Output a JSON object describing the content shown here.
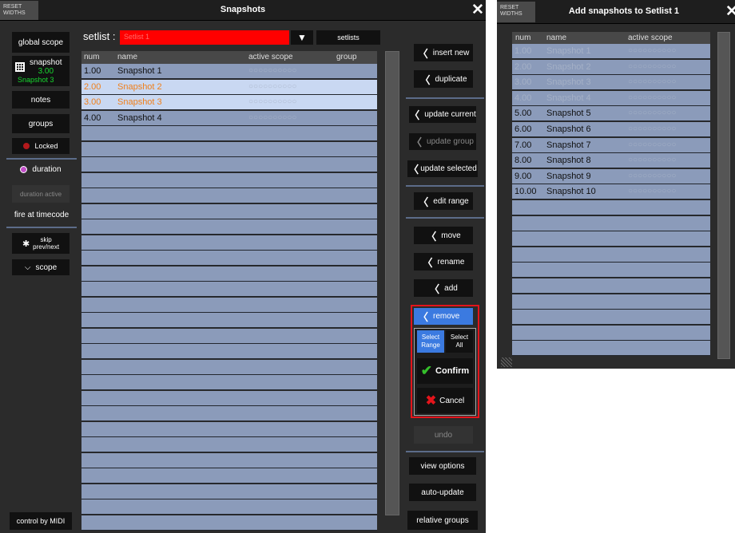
{
  "main": {
    "reset_label": "RESET\nWIDTHS",
    "title": "Snapshots",
    "setlist_label": "setlist :",
    "setlist_value": "Setlist 1",
    "setlists_button": "setlists",
    "columns": [
      "num",
      "name",
      "active scope",
      "group"
    ],
    "rows": [
      {
        "num": "1.00",
        "name": "Snapshot 1",
        "scope": "○○○○○○○○○○",
        "state": "normal"
      },
      {
        "num": "2.00",
        "name": "Snapshot 2",
        "scope": "○○○○○○○○○○",
        "state": "selected"
      },
      {
        "num": "3.00",
        "name": "Snapshot 3",
        "scope": "○○○○○○○○○○",
        "state": "selected"
      },
      {
        "num": "4.00",
        "name": "Snapshot 4",
        "scope": "○○○○○○○○○○",
        "state": "normal"
      }
    ],
    "empty_rows": 26
  },
  "left_panel": {
    "global_scope": "global scope",
    "snapshot_label": "snapshot",
    "snapshot_num": "3.00",
    "snapshot_name": "Snapshot 3",
    "notes": "notes",
    "groups": "groups",
    "locked": "Locked",
    "duration": "duration",
    "duration_active": "duration active",
    "fire_at_timecode": "fire at timecode",
    "skip": "skip\nprev/next",
    "scope": "scope",
    "control_by_midi": "control by MIDI"
  },
  "right_panel": {
    "insert_new": "insert new",
    "duplicate": "duplicate",
    "update_current": "update current",
    "update_group": "update group",
    "update_selected": "update selected",
    "edit_range": "edit range",
    "move": "move",
    "rename": "rename",
    "add": "add",
    "remove": "remove",
    "select_range": "Select\nRange",
    "select_all": "Select\nAll",
    "confirm": "Confirm",
    "cancel": "Cancel",
    "undo": "undo",
    "view_options": "view options",
    "auto_update": "auto-update",
    "relative_groups": "relative groups"
  },
  "add_window": {
    "reset_label": "RESET\nWIDTHS",
    "title": "Add snapshots to Setlist 1",
    "columns": [
      "num",
      "name",
      "active scope"
    ],
    "rows": [
      {
        "num": "1.00",
        "name": "Snapshot 1",
        "scope": "○○○○○○○○○○",
        "state": "disabled"
      },
      {
        "num": "2.00",
        "name": "Snapshot 2",
        "scope": "○○○○○○○○○○",
        "state": "disabled"
      },
      {
        "num": "3.00",
        "name": "Snapshot 3",
        "scope": "○○○○○○○○○○",
        "state": "disabled"
      },
      {
        "num": "4.00",
        "name": "Snapshot 4",
        "scope": "○○○○○○○○○○",
        "state": "disabled"
      },
      {
        "num": "5.00",
        "name": "Snapshot 5",
        "scope": "○○○○○○○○○○",
        "state": "normal"
      },
      {
        "num": "6.00",
        "name": "Snapshot 6",
        "scope": "○○○○○○○○○○",
        "state": "normal"
      },
      {
        "num": "7.00",
        "name": "Snapshot 7",
        "scope": "○○○○○○○○○○",
        "state": "normal"
      },
      {
        "num": "8.00",
        "name": "Snapshot 8",
        "scope": "○○○○○○○○○○",
        "state": "normal"
      },
      {
        "num": "9.00",
        "name": "Snapshot 9",
        "scope": "○○○○○○○○○○",
        "state": "normal"
      },
      {
        "num": "10.00",
        "name": "Snapshot 10",
        "scope": "○○○○○○○○○○",
        "state": "normal"
      }
    ],
    "empty_rows": 10
  },
  "colors": {
    "row_bg": "#8b9bba",
    "row_selected_bg": "#c9d8f2",
    "selected_text": "#f07f1a",
    "setlist_red": "#ff0000",
    "accent_blue": "#3b7ae0",
    "highlight_red": "#e4141b",
    "snapshot_green": "#18d830"
  }
}
